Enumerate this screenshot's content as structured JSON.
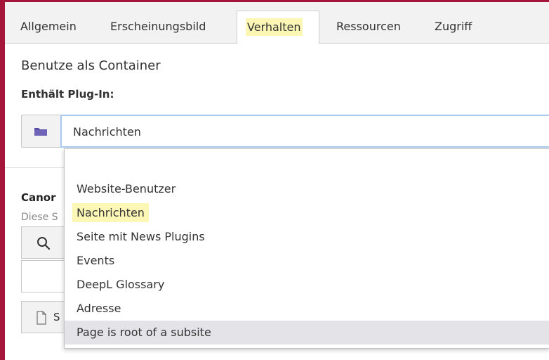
{
  "tabs": [
    {
      "label": "Allgemein"
    },
    {
      "label": "Erscheinungsbild"
    },
    {
      "label": "Verhalten",
      "active": true,
      "highlighted": true
    },
    {
      "label": "Ressourcen"
    },
    {
      "label": "Zugriff"
    }
  ],
  "section": {
    "container_label": "Benutze als Container",
    "plugin_label": "Enthält Plug-In:",
    "plugin_select": {
      "icon": "folder-icon",
      "value": "Nachrichten"
    }
  },
  "dropdown": {
    "options": [
      {
        "label": ""
      },
      {
        "label": "Website-Benutzer"
      },
      {
        "label": "Nachrichten",
        "highlighted": true
      },
      {
        "label": "Seite mit News Plugins"
      },
      {
        "label": "Events"
      },
      {
        "label": "DeepL Glossary"
      },
      {
        "label": "Adresse"
      },
      {
        "label": "Page is root of a subsite",
        "hovered": true
      }
    ]
  },
  "canonical": {
    "label_visible": "Canor",
    "description_visible": "Diese S",
    "search_icon": "search-icon",
    "button_icon": "document-icon",
    "button_label_visible": "S"
  },
  "colors": {
    "frame": "#a4163a",
    "tabbar_bg": "#f2f2f2",
    "highlight": "#fdf7b5",
    "focus_border": "#a9c9ee",
    "hover_bg": "#e3e3e8",
    "folder": "#5a4fa6"
  }
}
